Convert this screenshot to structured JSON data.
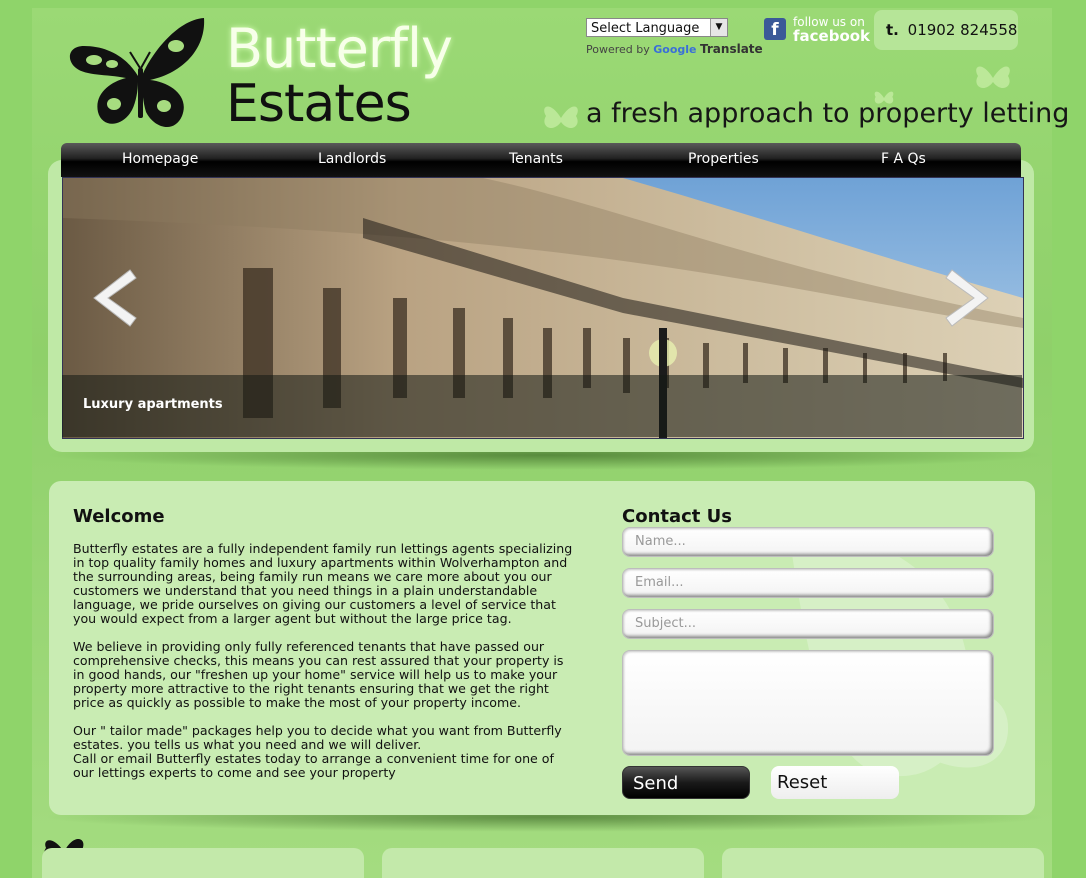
{
  "brand": {
    "line1": "Butterfly",
    "line2": "Estates"
  },
  "tagline": "a fresh approach to property letting",
  "translate": {
    "select_label": "Select Language",
    "powered": "Powered by",
    "google": "Google",
    "translate": "Translate"
  },
  "facebook": {
    "line1": "follow us on",
    "line2": "facebook",
    "icon": "f"
  },
  "phone": {
    "prefix": "t.",
    "number": "01902 824558"
  },
  "nav": [
    "Homepage",
    "Landlords",
    "Tenants",
    "Properties",
    "F A Qs"
  ],
  "slider": {
    "caption": "Luxury apartments"
  },
  "welcome": {
    "title": "Welcome",
    "p1": "Butterfly estates are a fully independent family run lettings agents specializing in top quality family homes and luxury apartments within Wolverhampton and the surrounding areas, being family run means we care more about you our customers we understand that you need things in a plain understandable language,  we pride ourselves on giving our customers a level of service that you would expect from a larger agent but without the large price tag.",
    "p2": "We believe in providing only fully referenced tenants that have passed our comprehensive checks, this means you can rest assured that your property is in good hands, our \"freshen up your home\" service will help us to make your property more attractive to the right tenants ensuring that we get the right price as quickly as possible to make the most of your property income.",
    "p3": "Our  \" tailor made\" packages help you to decide what you want from Butterfly estates. you tells us what you need and we will deliver.",
    "p4": "Call or email Butterfly estates today to arrange a convenient time for one of our lettings experts to come and see your property"
  },
  "contact": {
    "title": "Contact Us",
    "name_placeholder": "Name...",
    "email_placeholder": "Email...",
    "subject_placeholder": "Subject...",
    "send_label": "Send",
    "reset_label": "Reset"
  }
}
